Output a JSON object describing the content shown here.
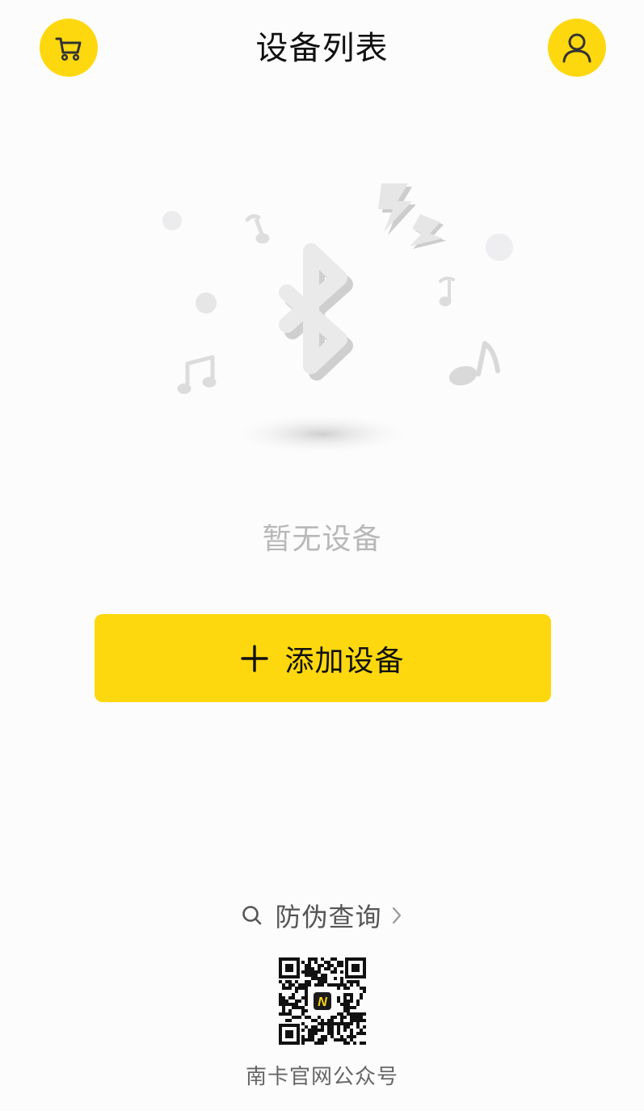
{
  "header": {
    "title": "设备列表",
    "cart_icon": "cart-icon",
    "user_icon": "user-icon"
  },
  "empty_state": {
    "illustration": "bluetooth-music-illustration",
    "message": "暂无设备"
  },
  "add_button": {
    "icon": "plus-icon",
    "label": "添加设备"
  },
  "footer": {
    "verify_icon": "search-icon",
    "verify_label": "防伪查询",
    "verify_chevron": "chevron-right-icon",
    "qr_logo_letter": "N",
    "qr_label": "南卡官网公众号"
  },
  "colors": {
    "accent": "#fed80e",
    "background": "#fcfcfc",
    "text_primary": "#111111",
    "text_muted": "#b8b8b8"
  }
}
